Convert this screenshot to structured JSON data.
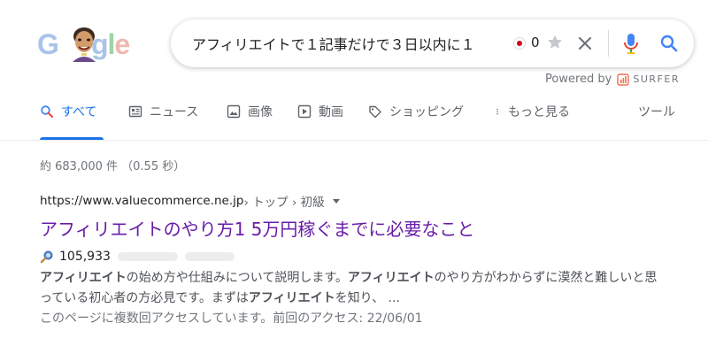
{
  "search": {
    "query": "アフィリエイトで１記事だけで３日以内に１",
    "flag_count": "0",
    "powered_by": "Powered by",
    "surfer_label": "SURFER"
  },
  "tabs": [
    {
      "label": "すべて",
      "icon": "search-icon",
      "active": true
    },
    {
      "label": "ニュース",
      "icon": "news-icon",
      "active": false
    },
    {
      "label": "画像",
      "icon": "image-icon",
      "active": false
    },
    {
      "label": "動画",
      "icon": "video-icon",
      "active": false
    },
    {
      "label": "ショッピング",
      "icon": "tag-icon",
      "active": false
    },
    {
      "label": "もっと見る",
      "icon": "more-vert-icon",
      "active": false
    },
    {
      "label": "ツール",
      "icon": "",
      "active": false
    }
  ],
  "stats": "約 683,000 件 （0.55 秒）",
  "result": {
    "url": "https://www.valuecommerce.ne.jp",
    "breadcrumbs": " › トップ › 初級",
    "title": "アフィリエイトのやり方1 5万円稼ぐまでに必要なこと",
    "metric_value": "105,933",
    "snippet": [
      {
        "text": "アフィリエイト",
        "bold": true
      },
      {
        "text": "の始め方や仕組みについて説明します。",
        "bold": false
      },
      {
        "text": "アフィリエイト",
        "bold": true
      },
      {
        "text": "のやり方がわからずに漠然と難しいと思っている初心者の方必見です。まずは",
        "bold": false
      },
      {
        "text": "アフィリエイト",
        "bold": true
      },
      {
        "text": "を知り、 ...",
        "bold": false
      }
    ],
    "visited": "このページに複数回アクセスしています。前回のアクセス: 22/06/01"
  },
  "colors": {
    "link_visited": "#681da8",
    "tab_active": "#1a73e8",
    "text_secondary": "#70757a"
  }
}
